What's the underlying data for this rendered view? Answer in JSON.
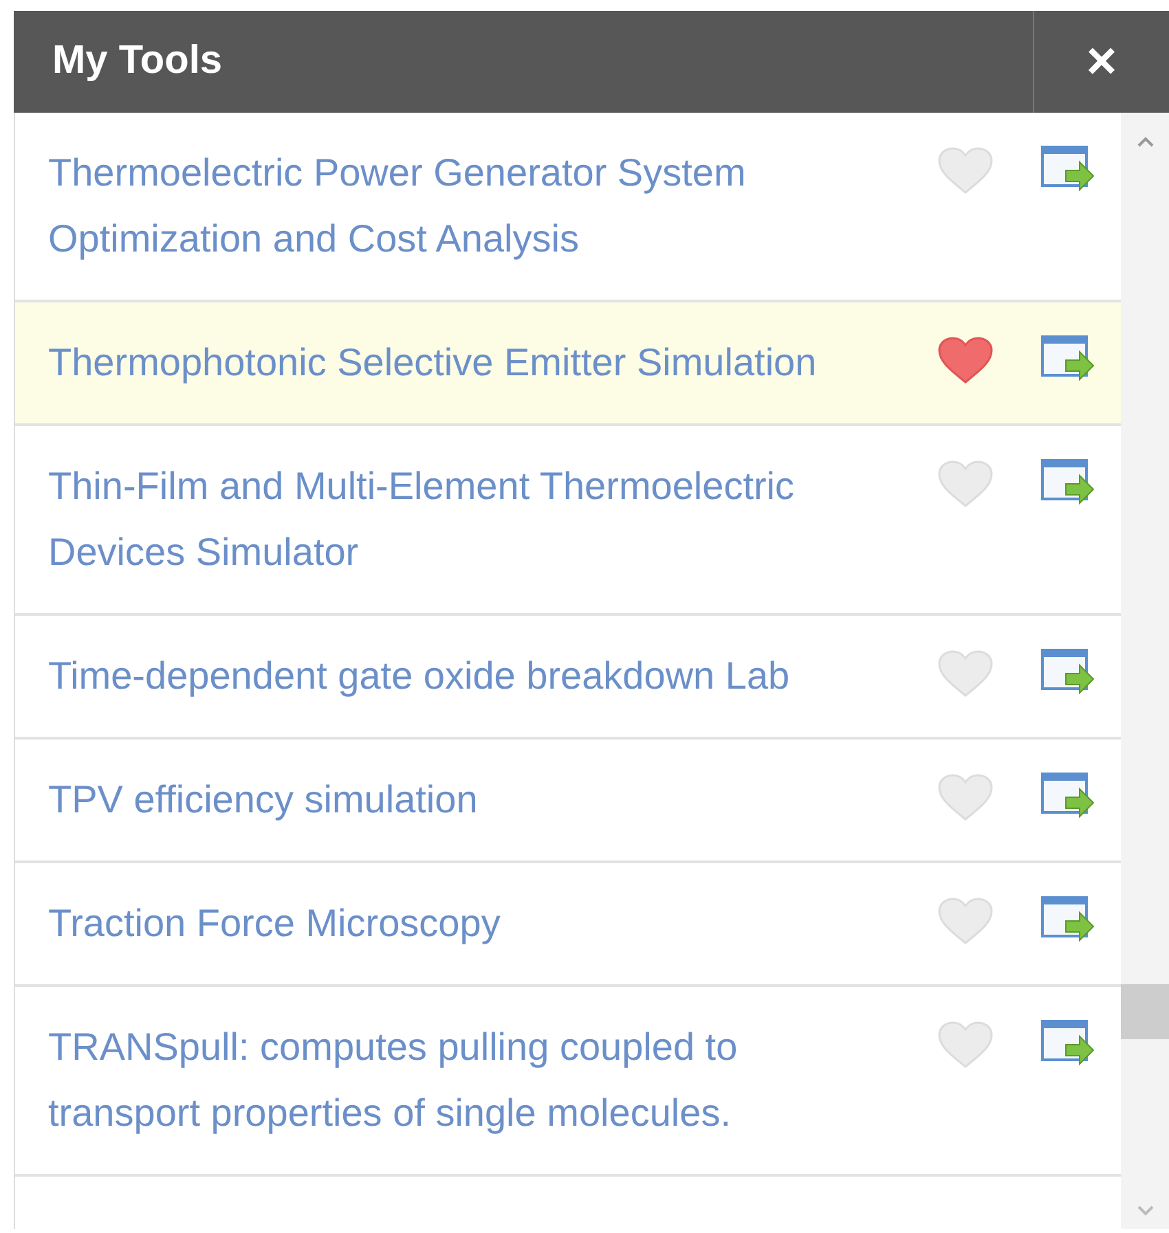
{
  "panel": {
    "title": "My Tools",
    "close": "×"
  },
  "tools": [
    {
      "name": "Thermoelectric Power Generator System Optimization and Cost Analysis",
      "favorite": false,
      "highlighted": false
    },
    {
      "name": "Thermophotonic Selective Emitter Simulation",
      "favorite": true,
      "highlighted": true
    },
    {
      "name": "Thin-Film and Multi-Element Thermoelectric Devices Simulator",
      "favorite": false,
      "highlighted": false
    },
    {
      "name": "Time-dependent gate oxide breakdown Lab",
      "favorite": false,
      "highlighted": false
    },
    {
      "name": "TPV efficiency simulation",
      "favorite": false,
      "highlighted": false
    },
    {
      "name": "Traction Force Microscopy",
      "favorite": false,
      "highlighted": false
    },
    {
      "name": "TRANSpull: computes pulling coupled to transport properties of single molecules.",
      "favorite": false,
      "highlighted": false
    }
  ]
}
